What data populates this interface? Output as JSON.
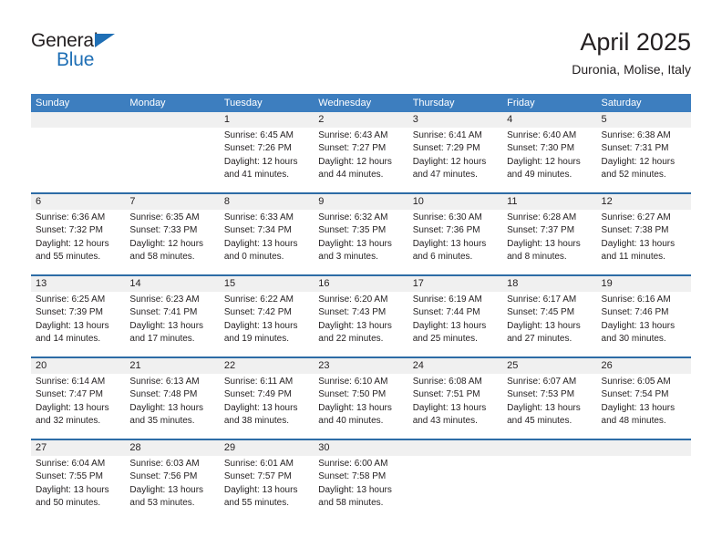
{
  "brand": {
    "name_part1": "General",
    "name_part2": "Blue",
    "triangle_icon": "triangle-icon",
    "accent_color": "#1f6fb5"
  },
  "header": {
    "title": "April 2025",
    "subtitle": "Duronia, Molise, Italy"
  },
  "theme": {
    "header_blue": "#3d7ebf",
    "separator_blue": "#2d6ca6",
    "daynum_band_gray": "#f0f0f0",
    "text_color": "#231f20"
  },
  "weekdays": [
    "Sunday",
    "Monday",
    "Tuesday",
    "Wednesday",
    "Thursday",
    "Friday",
    "Saturday"
  ],
  "weeks": [
    [
      {
        "day": "",
        "empty": true
      },
      {
        "day": "",
        "empty": true
      },
      {
        "day": "1",
        "sunrise": "Sunrise: 6:45 AM",
        "sunset": "Sunset: 7:26 PM",
        "daylight_l1": "Daylight: 12 hours",
        "daylight_l2": "and 41 minutes."
      },
      {
        "day": "2",
        "sunrise": "Sunrise: 6:43 AM",
        "sunset": "Sunset: 7:27 PM",
        "daylight_l1": "Daylight: 12 hours",
        "daylight_l2": "and 44 minutes."
      },
      {
        "day": "3",
        "sunrise": "Sunrise: 6:41 AM",
        "sunset": "Sunset: 7:29 PM",
        "daylight_l1": "Daylight: 12 hours",
        "daylight_l2": "and 47 minutes."
      },
      {
        "day": "4",
        "sunrise": "Sunrise: 6:40 AM",
        "sunset": "Sunset: 7:30 PM",
        "daylight_l1": "Daylight: 12 hours",
        "daylight_l2": "and 49 minutes."
      },
      {
        "day": "5",
        "sunrise": "Sunrise: 6:38 AM",
        "sunset": "Sunset: 7:31 PM",
        "daylight_l1": "Daylight: 12 hours",
        "daylight_l2": "and 52 minutes."
      }
    ],
    [
      {
        "day": "6",
        "sunrise": "Sunrise: 6:36 AM",
        "sunset": "Sunset: 7:32 PM",
        "daylight_l1": "Daylight: 12 hours",
        "daylight_l2": "and 55 minutes."
      },
      {
        "day": "7",
        "sunrise": "Sunrise: 6:35 AM",
        "sunset": "Sunset: 7:33 PM",
        "daylight_l1": "Daylight: 12 hours",
        "daylight_l2": "and 58 minutes."
      },
      {
        "day": "8",
        "sunrise": "Sunrise: 6:33 AM",
        "sunset": "Sunset: 7:34 PM",
        "daylight_l1": "Daylight: 13 hours",
        "daylight_l2": "and 0 minutes."
      },
      {
        "day": "9",
        "sunrise": "Sunrise: 6:32 AM",
        "sunset": "Sunset: 7:35 PM",
        "daylight_l1": "Daylight: 13 hours",
        "daylight_l2": "and 3 minutes."
      },
      {
        "day": "10",
        "sunrise": "Sunrise: 6:30 AM",
        "sunset": "Sunset: 7:36 PM",
        "daylight_l1": "Daylight: 13 hours",
        "daylight_l2": "and 6 minutes."
      },
      {
        "day": "11",
        "sunrise": "Sunrise: 6:28 AM",
        "sunset": "Sunset: 7:37 PM",
        "daylight_l1": "Daylight: 13 hours",
        "daylight_l2": "and 8 minutes."
      },
      {
        "day": "12",
        "sunrise": "Sunrise: 6:27 AM",
        "sunset": "Sunset: 7:38 PM",
        "daylight_l1": "Daylight: 13 hours",
        "daylight_l2": "and 11 minutes."
      }
    ],
    [
      {
        "day": "13",
        "sunrise": "Sunrise: 6:25 AM",
        "sunset": "Sunset: 7:39 PM",
        "daylight_l1": "Daylight: 13 hours",
        "daylight_l2": "and 14 minutes."
      },
      {
        "day": "14",
        "sunrise": "Sunrise: 6:23 AM",
        "sunset": "Sunset: 7:41 PM",
        "daylight_l1": "Daylight: 13 hours",
        "daylight_l2": "and 17 minutes."
      },
      {
        "day": "15",
        "sunrise": "Sunrise: 6:22 AM",
        "sunset": "Sunset: 7:42 PM",
        "daylight_l1": "Daylight: 13 hours",
        "daylight_l2": "and 19 minutes."
      },
      {
        "day": "16",
        "sunrise": "Sunrise: 6:20 AM",
        "sunset": "Sunset: 7:43 PM",
        "daylight_l1": "Daylight: 13 hours",
        "daylight_l2": "and 22 minutes."
      },
      {
        "day": "17",
        "sunrise": "Sunrise: 6:19 AM",
        "sunset": "Sunset: 7:44 PM",
        "daylight_l1": "Daylight: 13 hours",
        "daylight_l2": "and 25 minutes."
      },
      {
        "day": "18",
        "sunrise": "Sunrise: 6:17 AM",
        "sunset": "Sunset: 7:45 PM",
        "daylight_l1": "Daylight: 13 hours",
        "daylight_l2": "and 27 minutes."
      },
      {
        "day": "19",
        "sunrise": "Sunrise: 6:16 AM",
        "sunset": "Sunset: 7:46 PM",
        "daylight_l1": "Daylight: 13 hours",
        "daylight_l2": "and 30 minutes."
      }
    ],
    [
      {
        "day": "20",
        "sunrise": "Sunrise: 6:14 AM",
        "sunset": "Sunset: 7:47 PM",
        "daylight_l1": "Daylight: 13 hours",
        "daylight_l2": "and 32 minutes."
      },
      {
        "day": "21",
        "sunrise": "Sunrise: 6:13 AM",
        "sunset": "Sunset: 7:48 PM",
        "daylight_l1": "Daylight: 13 hours",
        "daylight_l2": "and 35 minutes."
      },
      {
        "day": "22",
        "sunrise": "Sunrise: 6:11 AM",
        "sunset": "Sunset: 7:49 PM",
        "daylight_l1": "Daylight: 13 hours",
        "daylight_l2": "and 38 minutes."
      },
      {
        "day": "23",
        "sunrise": "Sunrise: 6:10 AM",
        "sunset": "Sunset: 7:50 PM",
        "daylight_l1": "Daylight: 13 hours",
        "daylight_l2": "and 40 minutes."
      },
      {
        "day": "24",
        "sunrise": "Sunrise: 6:08 AM",
        "sunset": "Sunset: 7:51 PM",
        "daylight_l1": "Daylight: 13 hours",
        "daylight_l2": "and 43 minutes."
      },
      {
        "day": "25",
        "sunrise": "Sunrise: 6:07 AM",
        "sunset": "Sunset: 7:53 PM",
        "daylight_l1": "Daylight: 13 hours",
        "daylight_l2": "and 45 minutes."
      },
      {
        "day": "26",
        "sunrise": "Sunrise: 6:05 AM",
        "sunset": "Sunset: 7:54 PM",
        "daylight_l1": "Daylight: 13 hours",
        "daylight_l2": "and 48 minutes."
      }
    ],
    [
      {
        "day": "27",
        "sunrise": "Sunrise: 6:04 AM",
        "sunset": "Sunset: 7:55 PM",
        "daylight_l1": "Daylight: 13 hours",
        "daylight_l2": "and 50 minutes."
      },
      {
        "day": "28",
        "sunrise": "Sunrise: 6:03 AM",
        "sunset": "Sunset: 7:56 PM",
        "daylight_l1": "Daylight: 13 hours",
        "daylight_l2": "and 53 minutes."
      },
      {
        "day": "29",
        "sunrise": "Sunrise: 6:01 AM",
        "sunset": "Sunset: 7:57 PM",
        "daylight_l1": "Daylight: 13 hours",
        "daylight_l2": "and 55 minutes."
      },
      {
        "day": "30",
        "sunrise": "Sunrise: 6:00 AM",
        "sunset": "Sunset: 7:58 PM",
        "daylight_l1": "Daylight: 13 hours",
        "daylight_l2": "and 58 minutes."
      },
      {
        "day": "",
        "empty": true
      },
      {
        "day": "",
        "empty": true
      },
      {
        "day": "",
        "empty": true
      }
    ]
  ]
}
